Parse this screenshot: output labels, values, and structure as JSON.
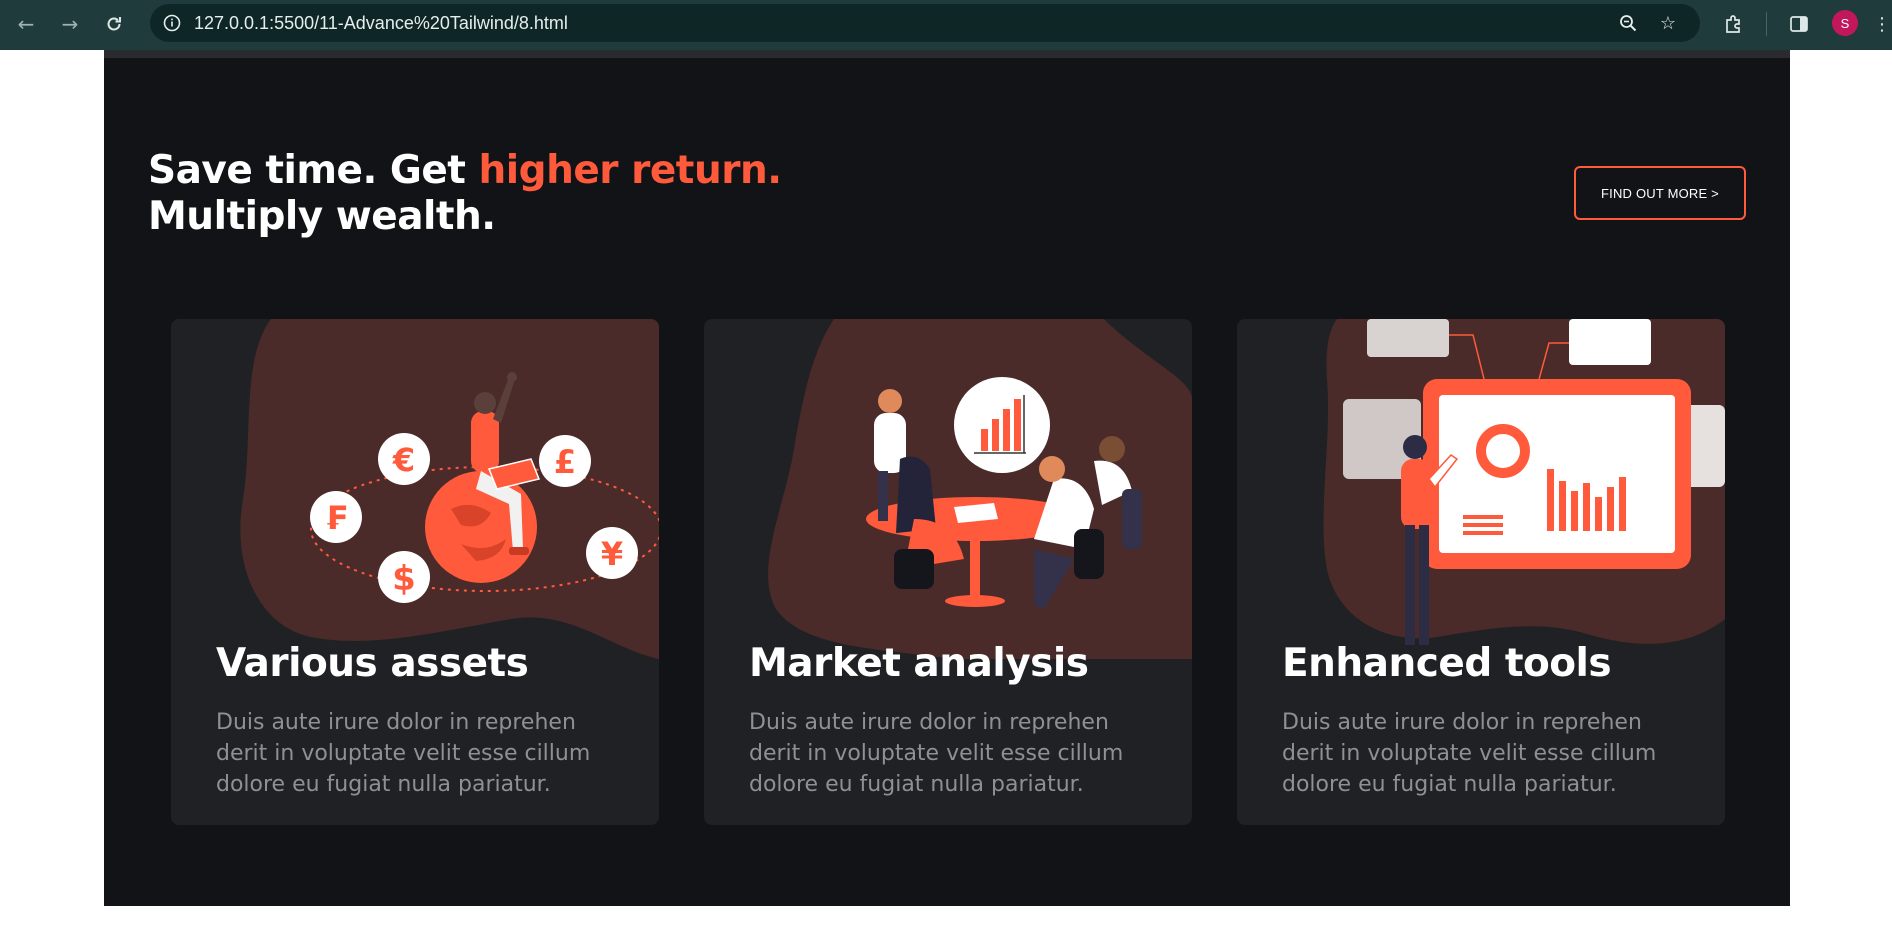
{
  "browser": {
    "url": "127.0.0.1:5500/11-Advance%20Tailwind/8.html",
    "profile_initial": "S"
  },
  "hero": {
    "headline_part1": "Save time. Get ",
    "headline_accent": "higher return.",
    "headline_line2": "Multiply wealth.",
    "cta_label": "FIND OUT MORE >"
  },
  "cards": [
    {
      "title": "Various assets",
      "description": "Duis aute irure dolor in reprehen derit in voluptate velit esse cillum dolore eu fugiat nulla pariatur.",
      "currency_symbols": [
        "€",
        "£",
        "₣",
        "$",
        "¥"
      ]
    },
    {
      "title": "Market analysis",
      "description": "Duis aute irure dolor in reprehen derit in voluptate velit esse cillum dolore eu fugiat nulla pariatur."
    },
    {
      "title": "Enhanced tools",
      "description": "Duis aute irure dolor in reprehen derit in voluptate velit esse cillum dolore eu fugiat nulla pariatur."
    }
  ],
  "colors": {
    "accent": "#ff5a3c",
    "page_bg": "#121316",
    "card_bg": "#202124",
    "blob": "#4a2b29"
  }
}
